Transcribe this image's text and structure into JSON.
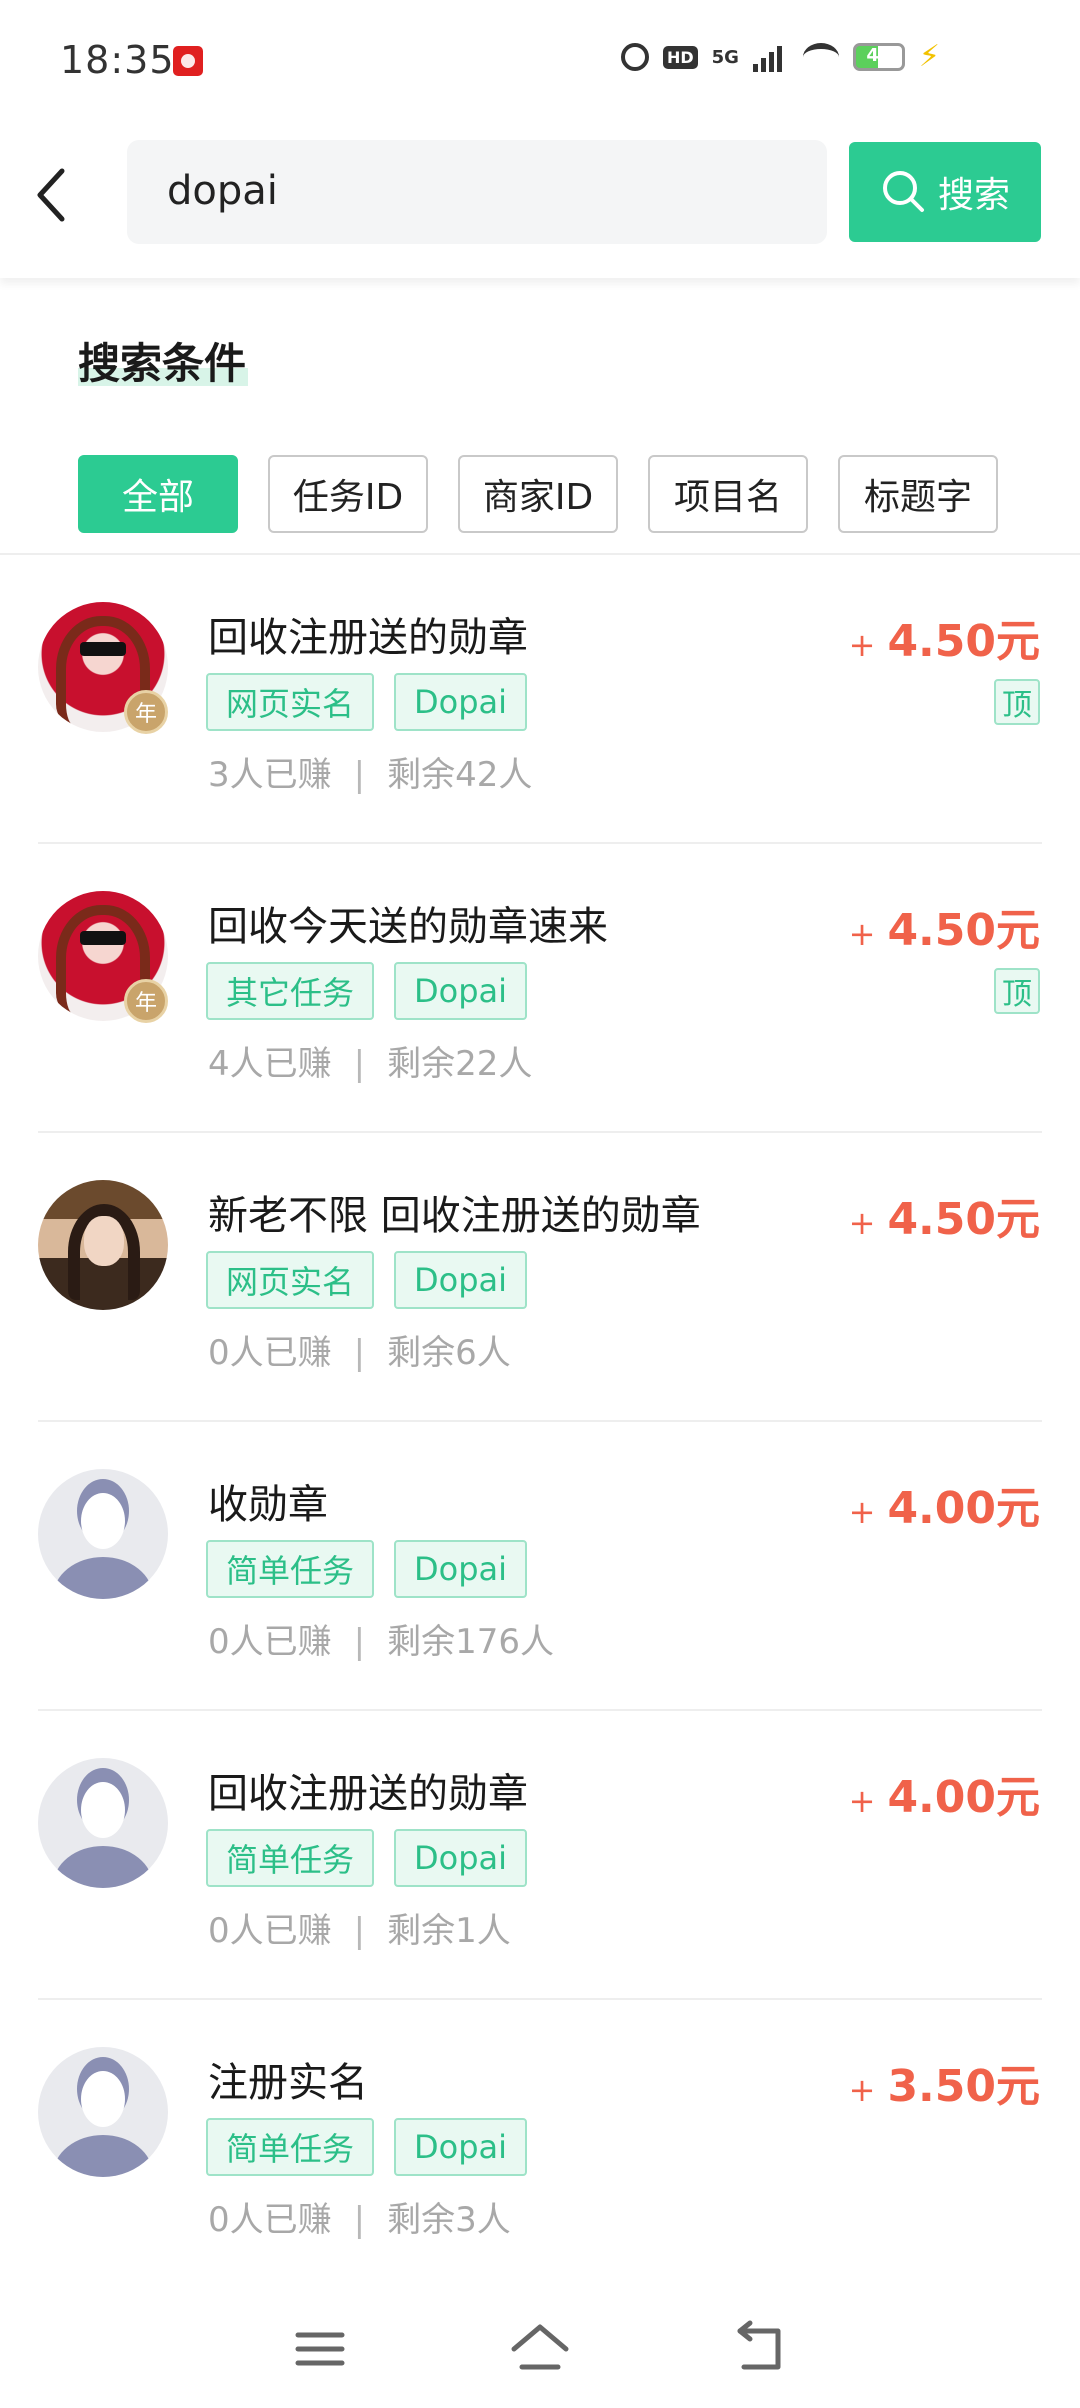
{
  "status_bar": {
    "time": "18:35",
    "hd": "HD",
    "network": "5G",
    "battery": "48"
  },
  "header": {
    "search_value": "dopai",
    "search_button": "搜索"
  },
  "conditions": {
    "title": "搜索条件",
    "filters": [
      "全部",
      "任务ID",
      "商家ID",
      "项目名",
      "标题字"
    ],
    "active_filter": "全部"
  },
  "tasks": [
    {
      "title": "回收注册送的勋章",
      "tags": [
        "网页实名",
        "Dopai"
      ],
      "earned": "3人已赚",
      "remaining": "剩余42人",
      "price_plus": "+",
      "price": "4.50元",
      "top_badge": "顶",
      "avatar": "red-photo-avatar",
      "year_badge": "年"
    },
    {
      "title": "回收今天送的勋章速来",
      "tags": [
        "其它任务",
        "Dopai"
      ],
      "earned": "4人已赚",
      "remaining": "剩余22人",
      "price_plus": "+",
      "price": "4.50元",
      "top_badge": "顶",
      "avatar": "red-photo-avatar",
      "year_badge": "年"
    },
    {
      "title": "新老不限 回收注册送的勋章",
      "tags": [
        "网页实名",
        "Dopai"
      ],
      "earned": "0人已赚",
      "remaining": "剩余6人",
      "price_plus": "+",
      "price": "4.50元",
      "avatar": "girl-photo-avatar"
    },
    {
      "title": "收勋章",
      "tags": [
        "简单任务",
        "Dopai"
      ],
      "earned": "0人已赚",
      "remaining": "剩余176人",
      "price_plus": "+",
      "price": "4.00元",
      "avatar": "default-avatar"
    },
    {
      "title": "回收注册送的勋章",
      "tags": [
        "简单任务",
        "Dopai"
      ],
      "earned": "0人已赚",
      "remaining": "剩余1人",
      "price_plus": "+",
      "price": "4.00元",
      "avatar": "default-avatar"
    },
    {
      "title": "注册实名",
      "tags": [
        "简单任务",
        "Dopai"
      ],
      "earned": "0人已赚",
      "remaining": "剩余3人",
      "price_plus": "+",
      "price": "3.50元",
      "avatar": "default-avatar"
    }
  ],
  "stats_separator": "|",
  "colors": {
    "accent": "#2ccb92",
    "price": "#f0624a",
    "tag_bg": "#e9f9f2",
    "tag_border": "#9ee3c8"
  },
  "nav": {
    "icons": [
      "menu-icon",
      "home-icon",
      "back-icon"
    ]
  }
}
